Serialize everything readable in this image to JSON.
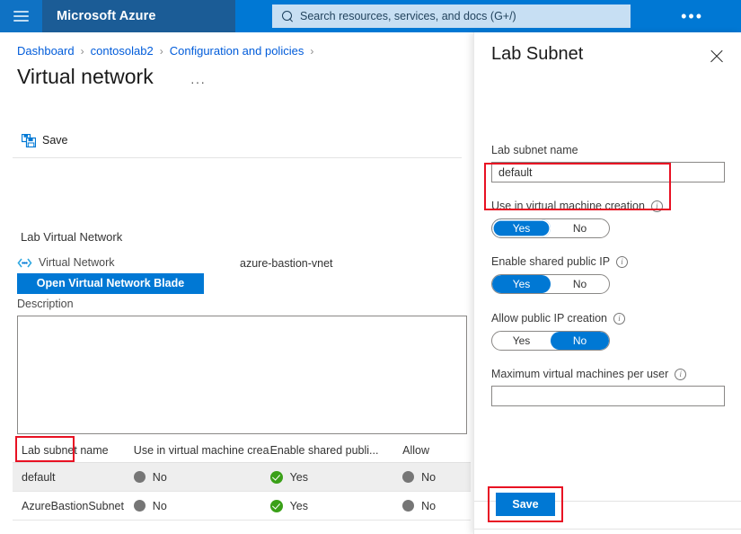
{
  "topbar": {
    "menu_icon": "hamburger-icon",
    "brand": "Microsoft Azure",
    "search_placeholder": "Search resources, services, and docs (G+/)",
    "search_value": "",
    "search_icon": "search-icon",
    "more_label": "•••",
    "colors": {
      "band": "#1b5c96",
      "bar": "#0078d4",
      "search_bg": "#c7dff3"
    }
  },
  "breadcrumb": {
    "items": [
      "Dashboard",
      "contosolab2",
      "Configuration and policies"
    ],
    "separator": "›",
    "trailing_separator": "›"
  },
  "page": {
    "title": "Virtual network",
    "title_more": "···"
  },
  "toolbar": {
    "save_label": "Save",
    "save_icon": "save-floppy-icon"
  },
  "lab_vnet": {
    "section_title": "Lab Virtual Network",
    "vnet_row_label": "Virtual Network",
    "vnet_icon": "virtual-network-icon",
    "vnet_value": "azure-bastion-vnet",
    "open_blade_label": "Open Virtual Network Blade",
    "description_label": "Description",
    "description_value": "",
    "description_placeholder": ""
  },
  "table": {
    "columns": [
      "Lab subnet name",
      "Use in virtual machine crea...",
      "Enable shared publi...",
      "Allow"
    ],
    "rows": [
      {
        "name": "default",
        "use_in_vm": "No",
        "use_in_vm_state": "no",
        "shared_public_ip": "Yes",
        "shared_public_ip_state": "yes",
        "allow_public_ip": "No",
        "allow_public_ip_state": "no",
        "selected": true
      },
      {
        "name": "AzureBastionSubnet",
        "use_in_vm": "No",
        "use_in_vm_state": "no",
        "shared_public_ip": "Yes",
        "shared_public_ip_state": "yes",
        "allow_public_ip": "No",
        "allow_public_ip_state": "no",
        "selected": false
      }
    ]
  },
  "panel": {
    "title": "Lab Subnet",
    "close_icon": "close-icon",
    "subnet_name_label": "Lab subnet name",
    "subnet_name_value": "default",
    "fields": [
      {
        "label": "Use in virtual machine creation",
        "info_icon": "info-icon",
        "yes": "Yes",
        "no": "No",
        "selected": "Yes",
        "highlighted": true
      },
      {
        "label": "Enable shared public IP",
        "info_icon": "info-icon",
        "yes": "Yes",
        "no": "No",
        "selected": "Yes",
        "highlighted": false
      },
      {
        "label": "Allow public IP creation",
        "info_icon": "info-icon",
        "yes": "Yes",
        "no": "No",
        "selected": "No",
        "highlighted": false
      }
    ],
    "max_vms_label": "Maximum virtual machines per user",
    "max_vms_value": "",
    "max_vms_info_icon": "info-icon",
    "save_label": "Save"
  },
  "annotations": {
    "highlight_color": "#e81123",
    "boxes": [
      "use-in-vm-toggle",
      "panel-save-button",
      "default-subnet-cell"
    ]
  },
  "colors": {
    "accent": "#0078d4",
    "link": "#015cda",
    "status_yes": "#3aa018",
    "status_no": "#767676",
    "highlight": "#e81123"
  }
}
